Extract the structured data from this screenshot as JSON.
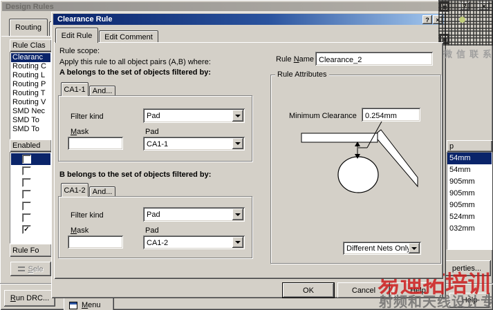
{
  "design_rules": {
    "title": "Design Rules",
    "titlebar": {
      "help": "?",
      "close": "×"
    },
    "routing_tab": "Routing",
    "rule_class_header": "Rule Clas",
    "rule_classes": [
      "Clearanc",
      "Routing C",
      "Routing L",
      "Routing P",
      "Routing T",
      "Routing V",
      "SMD Nec",
      "SMD To",
      "SMD To"
    ],
    "enabled_header": "Enabled",
    "checkmark": "✓",
    "rule_fo_header": "Rule Fo",
    "select_button": "Sele",
    "run_drc_button": "Run DRC...",
    "menu_button": "Menu",
    "gap_header": "p",
    "gap_values": [
      "54mm",
      "54mm",
      "905mm",
      "905mm",
      "905mm",
      "524mm",
      "032mm"
    ],
    "properties_button": "perties...",
    "help_button": "Help"
  },
  "clearance_dialog": {
    "title": "Clearance Rule",
    "titlebar": {
      "help": "?",
      "close": "×"
    },
    "tabs": {
      "edit_rule": "Edit Rule",
      "edit_comment": "Edit Comment"
    },
    "rule_scope": "Rule scope:",
    "apply_line": "Apply this rule to all object pairs (A,B) where:",
    "a_heading": "A belongs to the set of objects filtered by:",
    "b_heading": "B belongs to the set of objects filtered by:",
    "filter_a": {
      "tab": "CA1-1",
      "and_tab": "And...",
      "filter_kind_label": "Filter kind",
      "filter_kind_value": "Pad",
      "mask_label": "Mask",
      "mask_value": "",
      "pad_label": "Pad",
      "pad_value": "CA1-1"
    },
    "filter_b": {
      "tab": "CA1-2",
      "and_tab": "And...",
      "filter_kind_label": "Filter kind",
      "filter_kind_value": "Pad",
      "mask_label": "Mask",
      "mask_value": "",
      "pad_label": "Pad",
      "pad_value": "CA1-2"
    },
    "rule_name_label": "Rule Name",
    "rule_name_value": "Clearance_2",
    "rule_attributes_label": "Rule Attributes",
    "min_clearance_label": "Minimum Clearance",
    "min_clearance_value": "0.254mm",
    "connectivity_value": "Different Nets Only",
    "ok_button": "OK",
    "cancel_button": "Cancel",
    "help_button": "Help"
  },
  "watermarks": {
    "qr_caption": "微信联系",
    "brand": "易迪拓培训",
    "tagline": "射频和天线设计专家"
  },
  "colors": {
    "window_face": "#d4d0c8",
    "selection": "#0a246a",
    "active_title_start": "#0a246a",
    "active_title_end": "#a6caf0",
    "brand_red": "#cc1c1c"
  }
}
